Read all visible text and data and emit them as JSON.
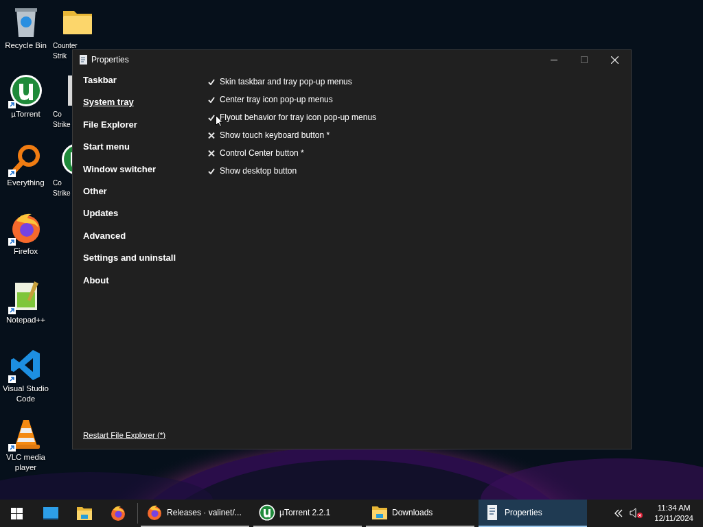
{
  "desktop": {
    "columns": [
      {
        "icons": [
          {
            "kind": "recycle-bin",
            "lines": [
              "Recycle Bin"
            ],
            "shortcut": false
          },
          {
            "kind": "utorrent",
            "lines": [
              "µTorrent"
            ],
            "shortcut": true
          },
          {
            "kind": "everything",
            "lines": [
              "Everything"
            ],
            "shortcut": true
          },
          {
            "kind": "firefox",
            "lines": [
              "Firefox"
            ],
            "shortcut": true
          },
          {
            "kind": "notepad",
            "lines": [
              "Notepad++"
            ],
            "shortcut": true
          },
          {
            "kind": "vscode",
            "lines": [
              "Visual Studio",
              "Code"
            ],
            "shortcut": true
          },
          {
            "kind": "vlc",
            "lines": [
              "VLC media",
              "player"
            ],
            "shortcut": true
          }
        ]
      },
      {
        "icons": [
          {
            "kind": "folder",
            "lines": [
              "Counter",
              "Strik"
            ],
            "shortcut": false
          },
          {
            "kind": "document",
            "lines": [
              "Co",
              "Strike"
            ],
            "shortcut": false
          },
          {
            "kind": "utorrent",
            "lines": [
              "Co",
              "Strike"
            ],
            "shortcut": false
          }
        ]
      }
    ]
  },
  "window": {
    "title": "Properties",
    "sidebar": {
      "items": [
        {
          "label": "Taskbar",
          "selected": false
        },
        {
          "label": "System tray",
          "selected": true
        },
        {
          "label": "File Explorer",
          "selected": false
        },
        {
          "label": "Start menu",
          "selected": false
        },
        {
          "label": "Window switcher",
          "selected": false
        },
        {
          "label": "Other",
          "selected": false
        },
        {
          "label": "Updates",
          "selected": false
        },
        {
          "label": "Advanced",
          "selected": false
        },
        {
          "label": "Settings and uninstall",
          "selected": false
        },
        {
          "label": "About",
          "selected": false
        }
      ]
    },
    "options": [
      {
        "label": "Skin taskbar and tray pop-up menus",
        "checked": true
      },
      {
        "label": "Center tray icon pop-up menus",
        "checked": true
      },
      {
        "label": "Flyout behavior for tray icon pop-up menus",
        "checked": true
      },
      {
        "label": "Show touch keyboard button *",
        "checked": false
      },
      {
        "label": "Control Center button *",
        "checked": false
      },
      {
        "label": "Show desktop button",
        "checked": true
      }
    ],
    "footer_link": "Restart File Explorer (*)"
  },
  "taskbar": {
    "pinned": [
      {
        "kind": "start"
      },
      {
        "kind": "task-view"
      },
      {
        "kind": "explorer"
      },
      {
        "kind": "firefox"
      }
    ],
    "buttons": [
      {
        "kind": "firefox",
        "label": "Releases · valinet/...",
        "selected": false
      },
      {
        "kind": "utorrent",
        "label": "µTorrent 2.2.1",
        "selected": false
      },
      {
        "kind": "explorer",
        "label": "Downloads",
        "selected": false
      },
      {
        "kind": "properties",
        "label": "Properties",
        "selected": true
      }
    ],
    "clock": {
      "time": "11:34 AM",
      "date": "12/11/2024"
    }
  }
}
